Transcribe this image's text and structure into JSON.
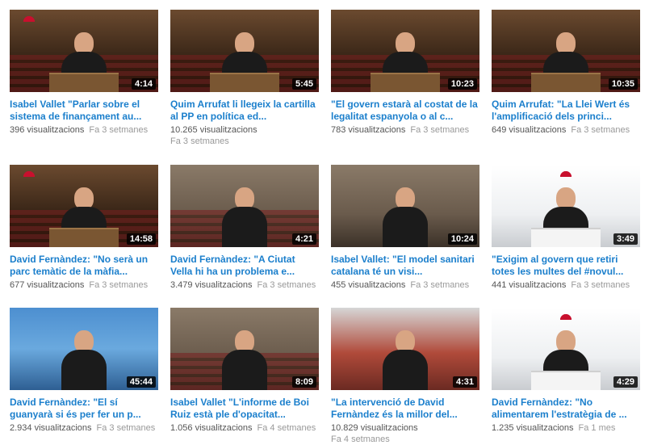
{
  "videos": [
    {
      "title": "Isabel Vallet \"Parlar sobre el sistema de finançament au...",
      "duration": "4:14",
      "views": "396 visualitzacions",
      "age": "Fa 3 setmanes"
    },
    {
      "title": "Quim Arrufat li llegeix la cartilla al PP en política ed...",
      "duration": "5:45",
      "views": "10.265 visualitzacions",
      "age": "Fa 3 setmanes"
    },
    {
      "title": "\"El govern estarà al costat de la legalitat espanyola o al c...",
      "duration": "10:23",
      "views": "783 visualitzacions",
      "age": "Fa 3 setmanes"
    },
    {
      "title": "Quim Arrufat: \"La Llei Wert és l'amplificació dels princi...",
      "duration": "10:35",
      "views": "649 visualitzacions",
      "age": "Fa 3 setmanes"
    },
    {
      "title": "David Fernàndez: \"No serà un parc temàtic de la màfia...",
      "duration": "14:58",
      "views": "677 visualitzacions",
      "age": "Fa 3 setmanes"
    },
    {
      "title": "David Fernàndez: \"A Ciutat Vella hi ha un problema e...",
      "duration": "4:21",
      "views": "3.479 visualitzacions",
      "age": "Fa 3 setmanes"
    },
    {
      "title": "Isabel Vallet: \"El model sanitari catalana té un visi...",
      "duration": "10:24",
      "views": "455 visualitzacions",
      "age": "Fa 3 setmanes"
    },
    {
      "title": "\"Exigim al govern que retiri totes les multes del #novul...",
      "duration": "3:49",
      "views": "441 visualitzacions",
      "age": "Fa 3 setmanes"
    },
    {
      "title": "David Fernàndez: \"El sí guanyarà si és per fer un p...",
      "duration": "45:44",
      "views": "2.934 visualitzacions",
      "age": "Fa 3 setmanes"
    },
    {
      "title": "Isabel Vallet \"L'informe de Boi Ruiz està ple d'opacitat...",
      "duration": "8:09",
      "views": "1.056 visualitzacions",
      "age": "Fa 4 setmanes"
    },
    {
      "title": "\"La intervenció de David Fernàndez és la millor del...",
      "duration": "4:31",
      "views": "10.829 visualitzacions",
      "age": "Fa 4 setmanes"
    },
    {
      "title": "David Fernàndez: \"No alimentarem l'estratègia de ...",
      "duration": "4:29",
      "views": "1.235 visualitzacions",
      "age": "Fa 1 mes"
    }
  ],
  "icons": {
    "logo": "parliament-logo-icon"
  },
  "colors": {
    "title_link": "#1b7fcc",
    "duration_bg": "#000000",
    "meta_text": "#555555",
    "age_text": "#999999"
  }
}
